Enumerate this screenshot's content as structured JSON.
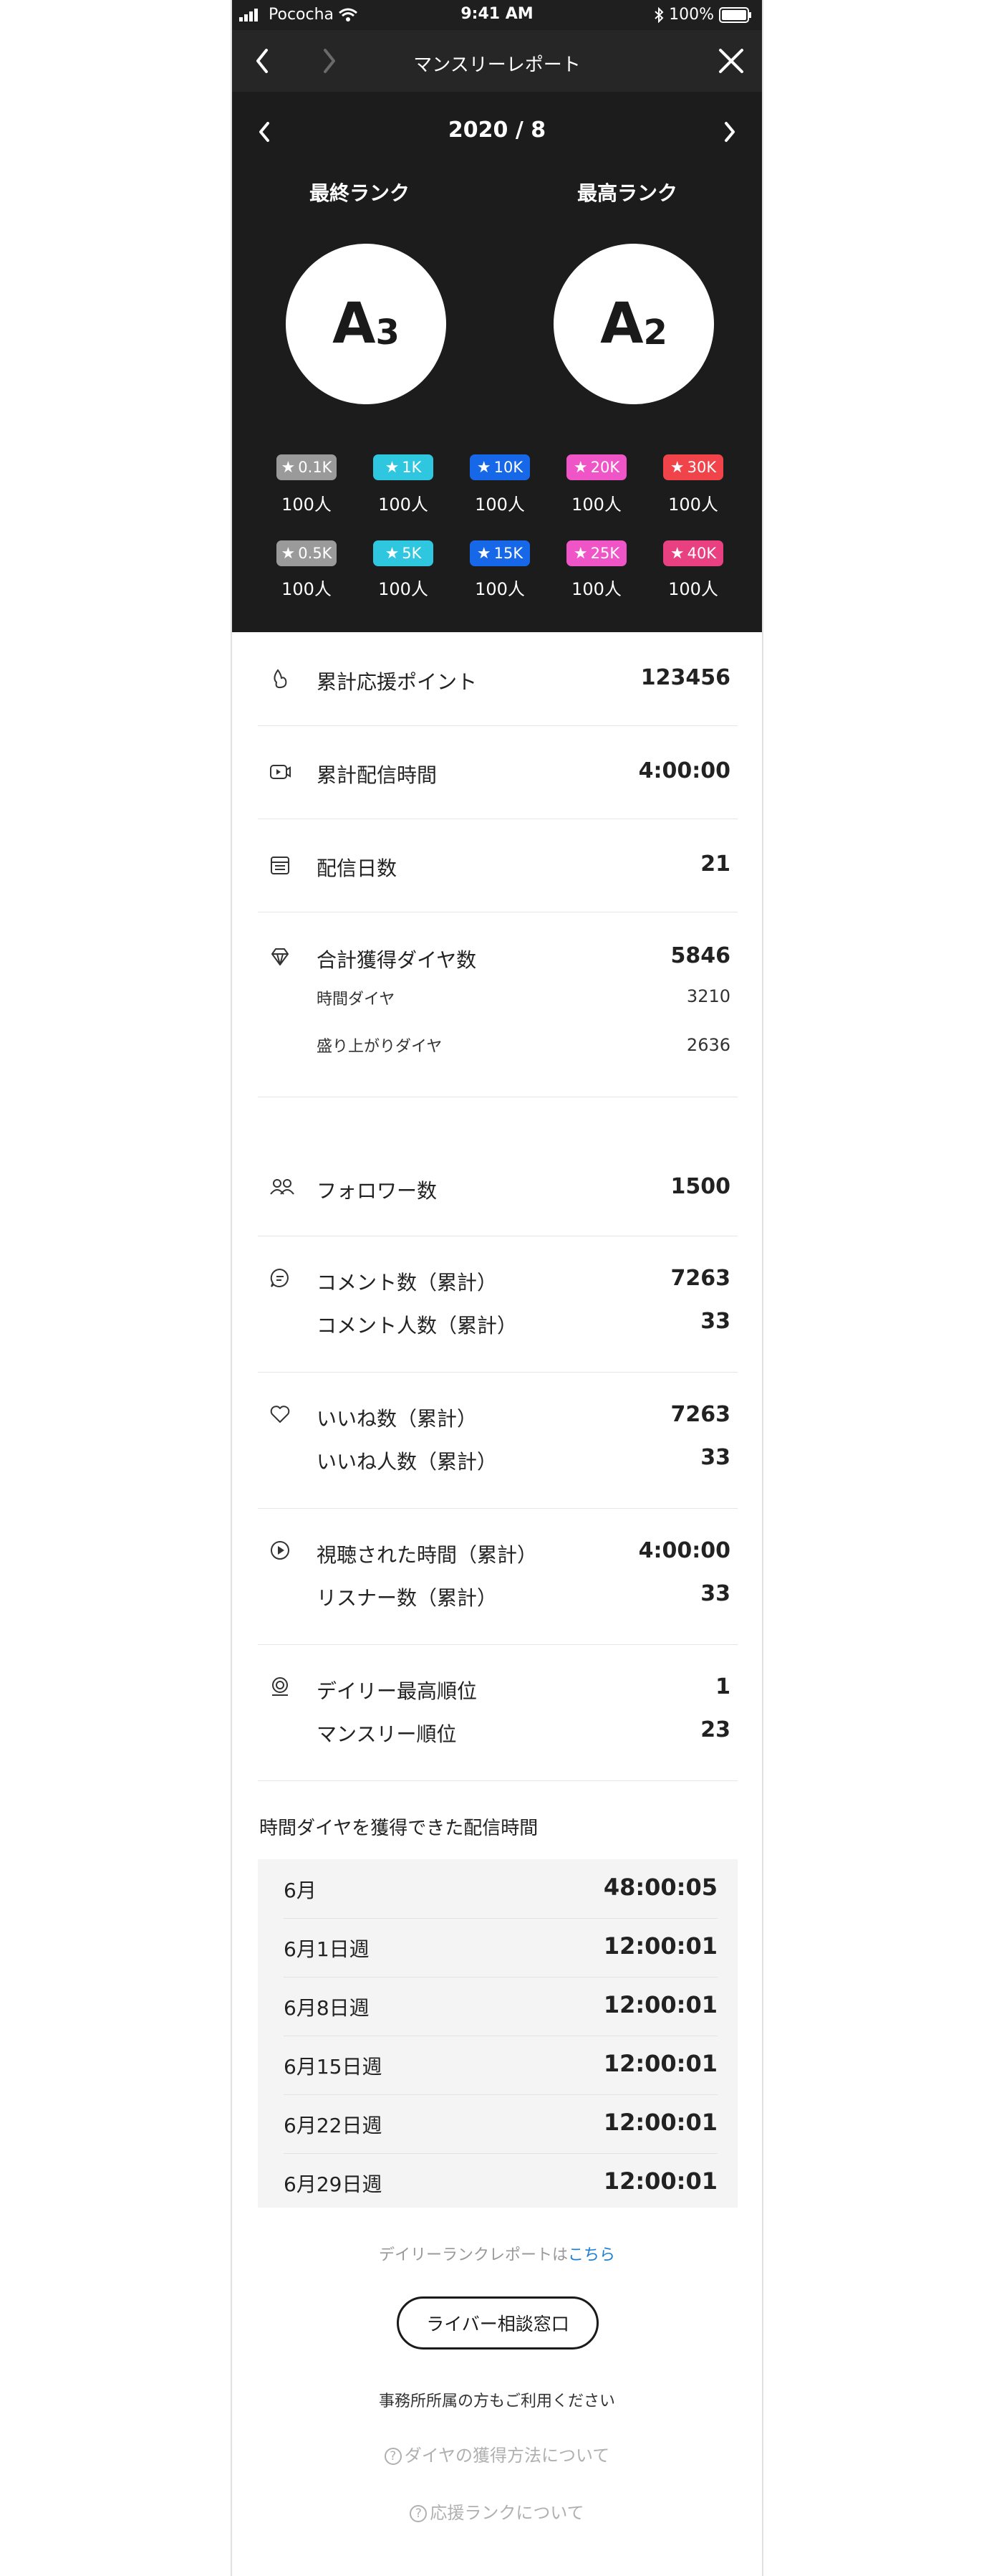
{
  "status_bar": {
    "carrier": "Pococha",
    "time": "9:41 AM",
    "battery": "100%"
  },
  "nav": {
    "title": "マンスリーレポート"
  },
  "period": {
    "label": "2020 / 8"
  },
  "ranks": {
    "final": {
      "title": "最終ランク",
      "letter": "A",
      "number": "3"
    },
    "highest": {
      "title": "最高ランク",
      "letter": "A",
      "number": "2"
    }
  },
  "badges": [
    {
      "label": "0.1K",
      "count": "100人",
      "color": "#9a9a9a"
    },
    {
      "label": "1K",
      "count": "100人",
      "color": "#2fc6e0"
    },
    {
      "label": "10K",
      "count": "100人",
      "color": "#1668e8"
    },
    {
      "label": "20K",
      "count": "100人",
      "color": "#f055c8"
    },
    {
      "label": "30K",
      "count": "100人",
      "color": "#f0444a"
    },
    {
      "label": "0.5K",
      "count": "100人",
      "color": "#9a9a9a"
    },
    {
      "label": "5K",
      "count": "100人",
      "color": "#2fc6e0"
    },
    {
      "label": "15K",
      "count": "100人",
      "color": "#1668e8"
    },
    {
      "label": "25K",
      "count": "100人",
      "color": "#f055c8"
    },
    {
      "label": "40K",
      "count": "100人",
      "color": "#e84080"
    }
  ],
  "stats": {
    "support_points": {
      "label": "累計応援ポイント",
      "value": "123456"
    },
    "stream_time": {
      "label": "累計配信時間",
      "value": "4:00:00"
    },
    "stream_days": {
      "label": "配信日数",
      "value": "21"
    },
    "diamonds": {
      "label": "合計獲得ダイヤ数",
      "value": "5846",
      "time_label": "時間ダイヤ",
      "time_value": "3210",
      "hype_label": "盛り上がりダイヤ",
      "hype_value": "2636"
    },
    "followers": {
      "label": "フォロワー数",
      "value": "1500"
    },
    "comments": {
      "label": "コメント数（累計）",
      "value": "7263",
      "people_label": "コメント人数（累計）",
      "people_value": "33"
    },
    "likes": {
      "label": "いいね数（累計）",
      "value": "7263",
      "people_label": "いいね人数（累計）",
      "people_value": "33"
    },
    "watch": {
      "label": "視聴された時間（累計）",
      "value": "4:00:00",
      "people_label": "リスナー数（累計）",
      "people_value": "33"
    },
    "ranking": {
      "label": "デイリー最高順位",
      "value": "1",
      "monthly_label": "マンスリー順位",
      "monthly_value": "23"
    }
  },
  "time_section": {
    "title": "時間ダイヤを獲得できた配信時間",
    "rows": [
      {
        "label": "6月",
        "value": "48:00:05"
      },
      {
        "label": "6月1日週",
        "value": "12:00:01"
      },
      {
        "label": "6月8日週",
        "value": "12:00:01"
      },
      {
        "label": "6月15日週",
        "value": "12:00:01"
      },
      {
        "label": "6月22日週",
        "value": "12:00:01"
      },
      {
        "label": "6月29日週",
        "value": "12:00:01"
      }
    ]
  },
  "footer": {
    "daily_prefix": "デイリーランクレポートは",
    "daily_link": "こちら",
    "consult_button": "ライバー相談窓口",
    "office_note": "事務所所属の方もご利用ください",
    "diamond_help": "ダイヤの獲得方法について",
    "rank_help": "応援ランクについて"
  }
}
